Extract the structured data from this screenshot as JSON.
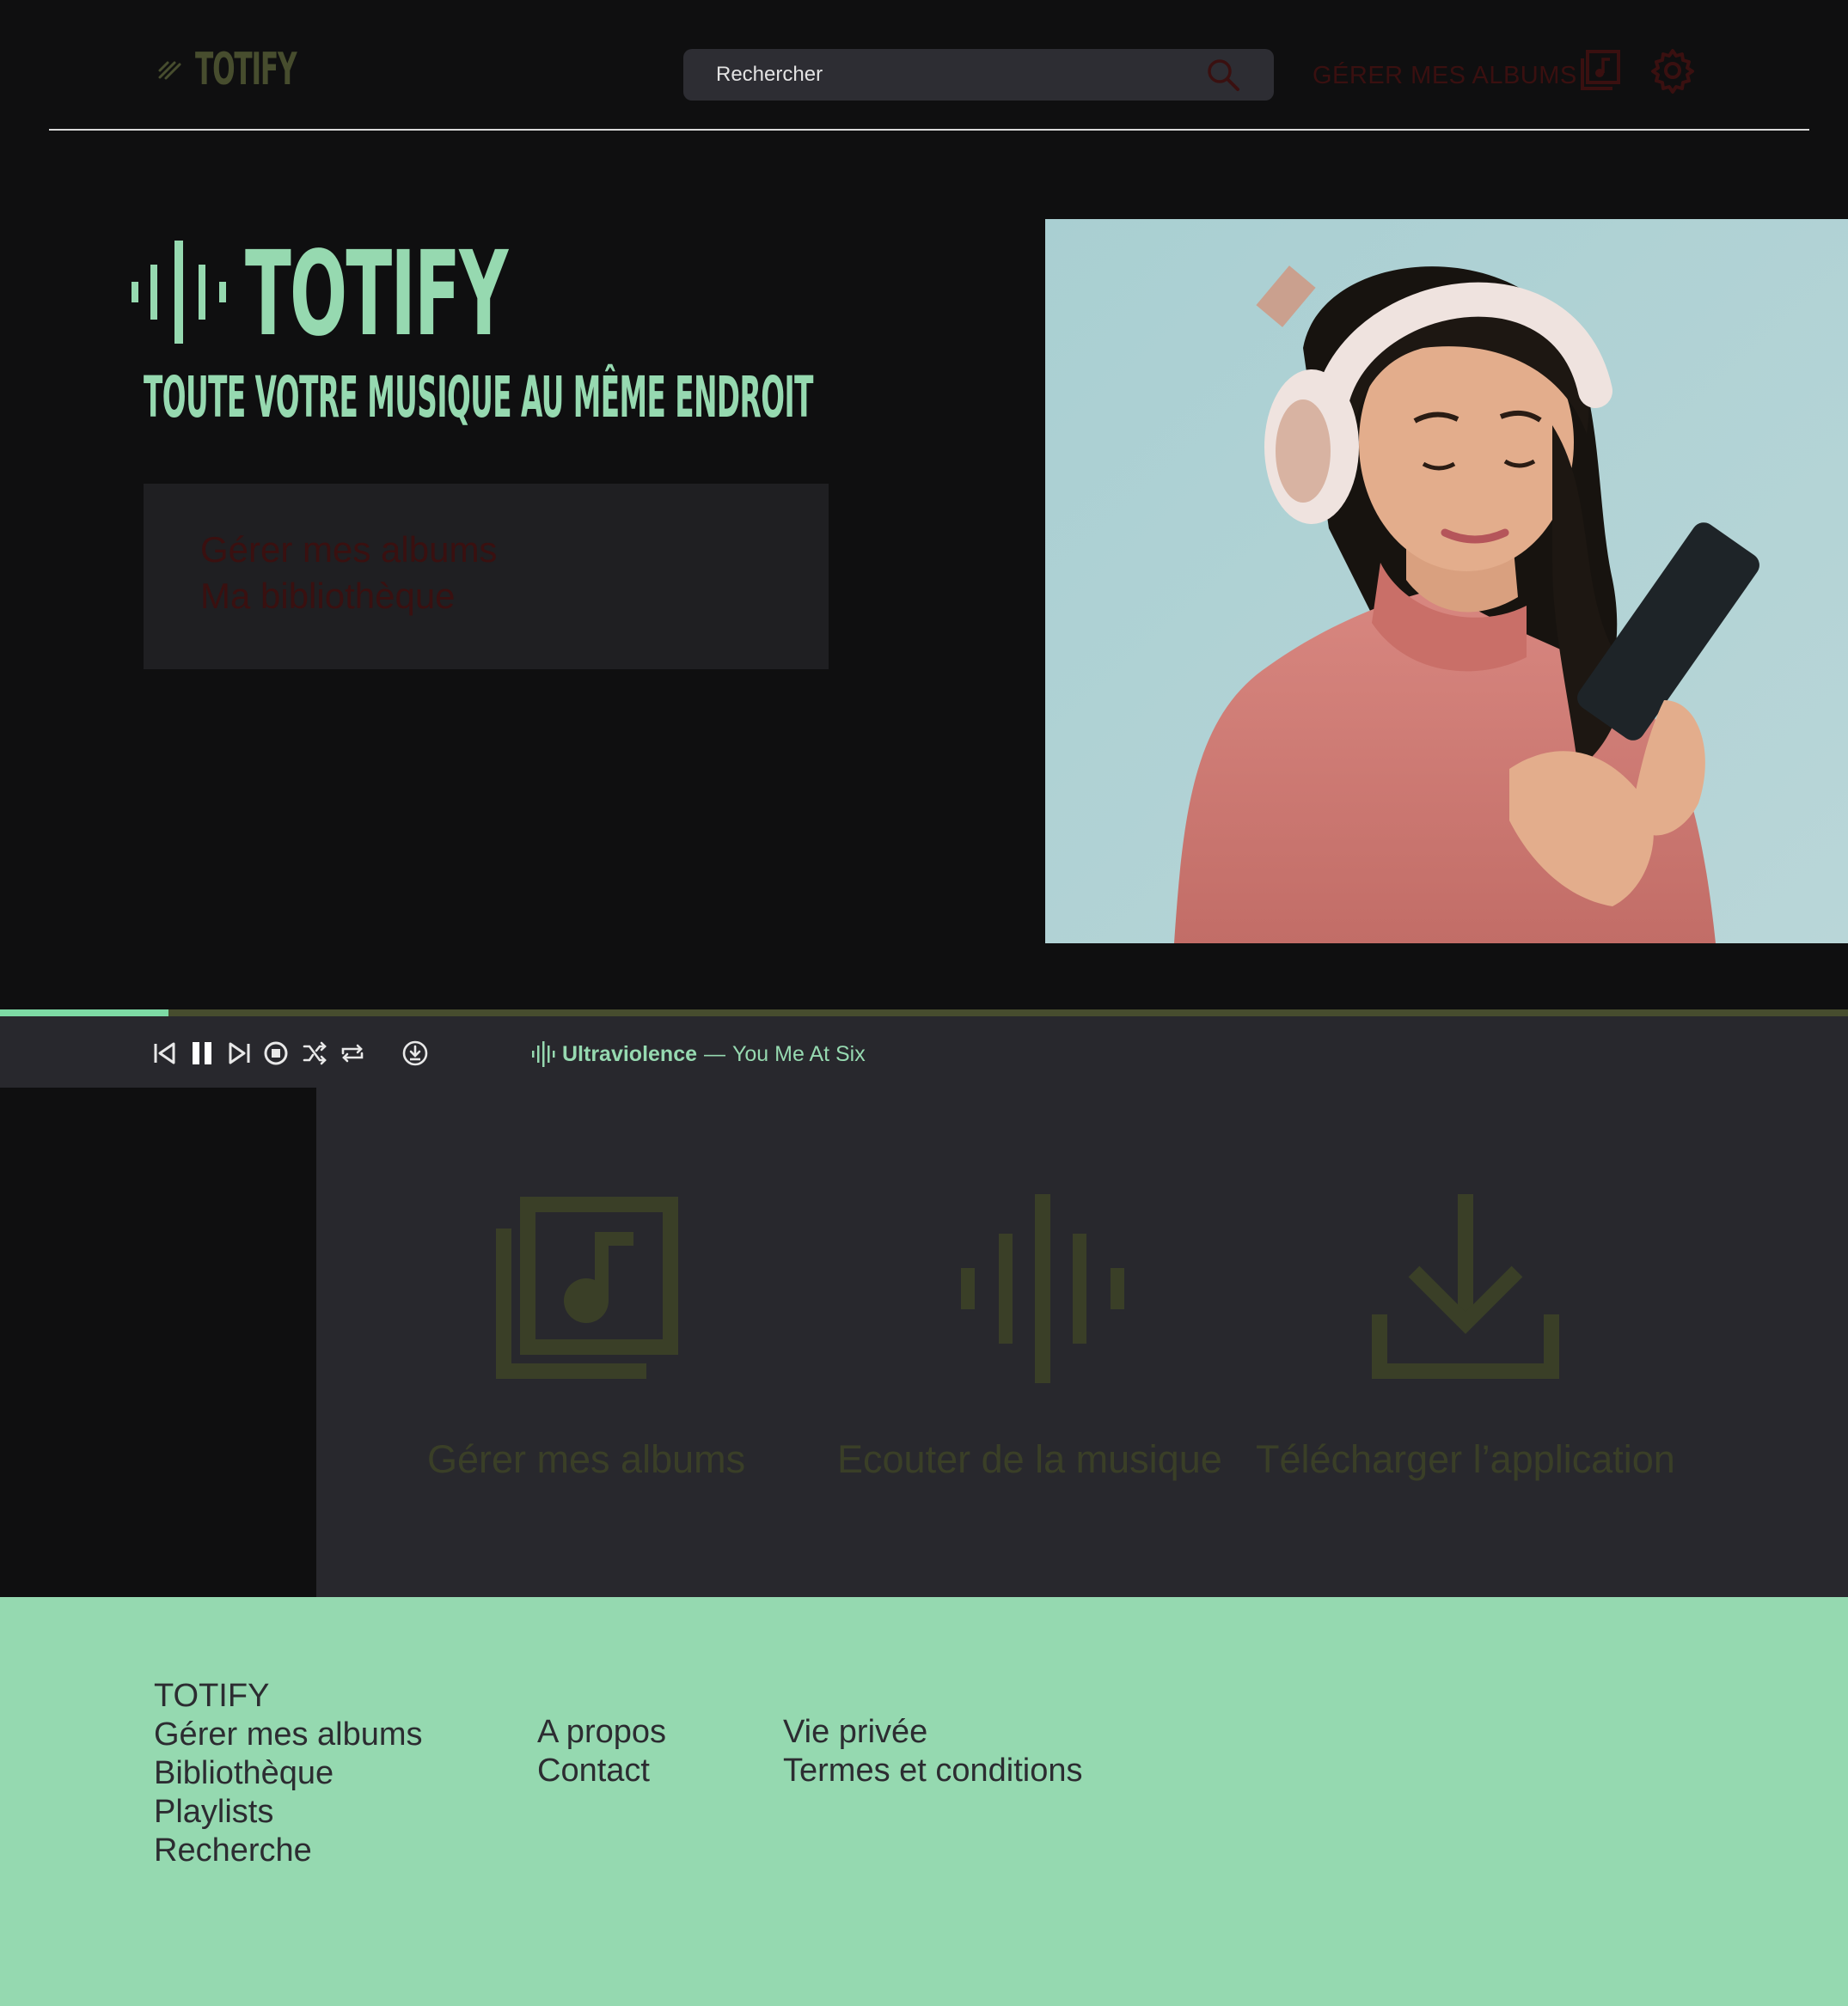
{
  "header": {
    "brand": "TOTIFY",
    "search_placeholder": "Rechercher",
    "nav_albums": "GÉRER MES ALBUMS",
    "icons": [
      "hatch-logo-icon",
      "search-icon",
      "albums-icon",
      "gear-icon"
    ]
  },
  "hero": {
    "brand": "TOTIFY",
    "tagline": "TOUTE VOTRE MUSIQUE AU MÊME ENDROIT",
    "links": [
      "Gérer mes albums",
      "Ma bibliothèque"
    ]
  },
  "player": {
    "progress": 0.091,
    "track_title": "Ultraviolence",
    "separator": "—",
    "artist": "You Me At Six",
    "controls": [
      "previous-icon",
      "pause-icon",
      "next-icon",
      "stop-icon",
      "shuffle-icon",
      "repeat-icon",
      "download-icon"
    ]
  },
  "features": [
    {
      "label": "Gérer mes albums",
      "icon": "albums-icon"
    },
    {
      "label": "Ecouter de la musique",
      "icon": "soundwave-icon"
    },
    {
      "label": "Télécharger l’application",
      "icon": "download-icon"
    }
  ],
  "footer": {
    "col1": [
      "TOTIFY",
      "Gérer mes albums",
      "Bibliothèque",
      "Playlists",
      "Recherche"
    ],
    "col2": [
      "A propos",
      "Contact"
    ],
    "col3": [
      "Vie privée",
      "Termes et conditions"
    ]
  },
  "colors": {
    "background": "#0f0f10",
    "accent_green": "#96d9b0",
    "olive": "#474d2e",
    "dark_red": "#3a1010",
    "panel": "#28282d"
  }
}
